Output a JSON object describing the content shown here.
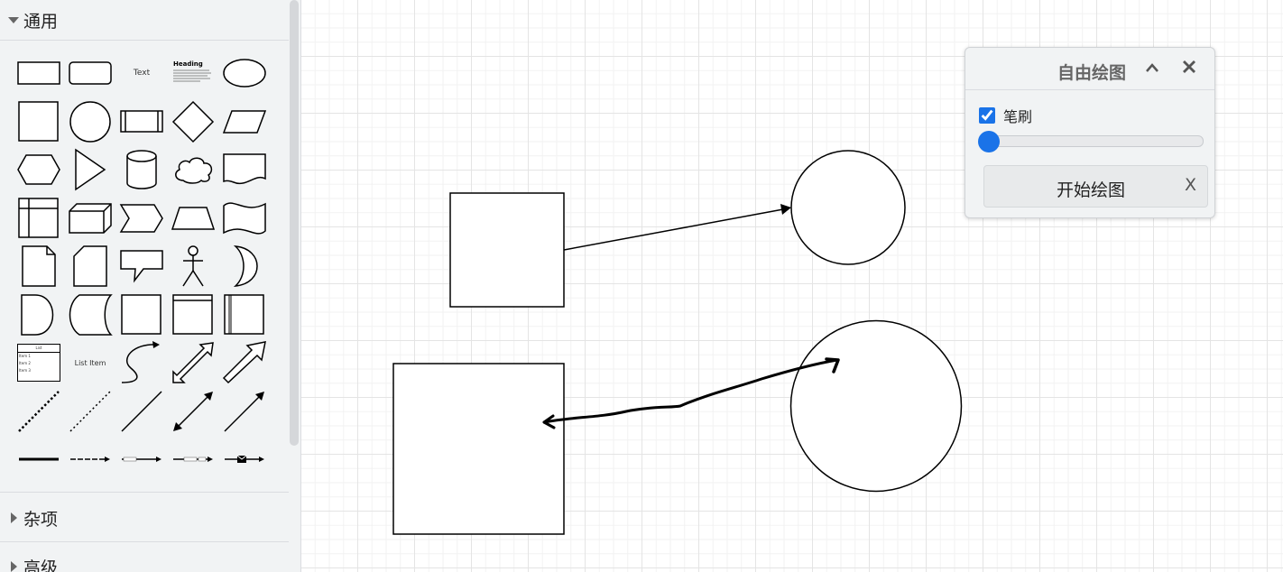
{
  "sidebar": {
    "sections": [
      {
        "label": "通用",
        "expanded": true
      },
      {
        "label": "杂项",
        "expanded": false
      },
      {
        "label": "高级",
        "expanded": false
      }
    ],
    "palette_text": {
      "text_shape": "Text",
      "heading_shape": "Heading",
      "list_item_shape": "List Item",
      "list_header": "List",
      "list_items": [
        "Item 1",
        "Item 2",
        "Item 3"
      ]
    }
  },
  "freehand_panel": {
    "title": "自由绘图",
    "collapse_icon": "chevron-up",
    "close_icon": "close",
    "brush_label": "笔刷",
    "brush_checked": true,
    "brush_size": 0,
    "start_button_label": "开始绘图",
    "start_button_x": "X"
  },
  "colors": {
    "accent": "#1a73e8",
    "sidebar_bg": "#f1f3f4",
    "grid": "#e4e4e4"
  }
}
